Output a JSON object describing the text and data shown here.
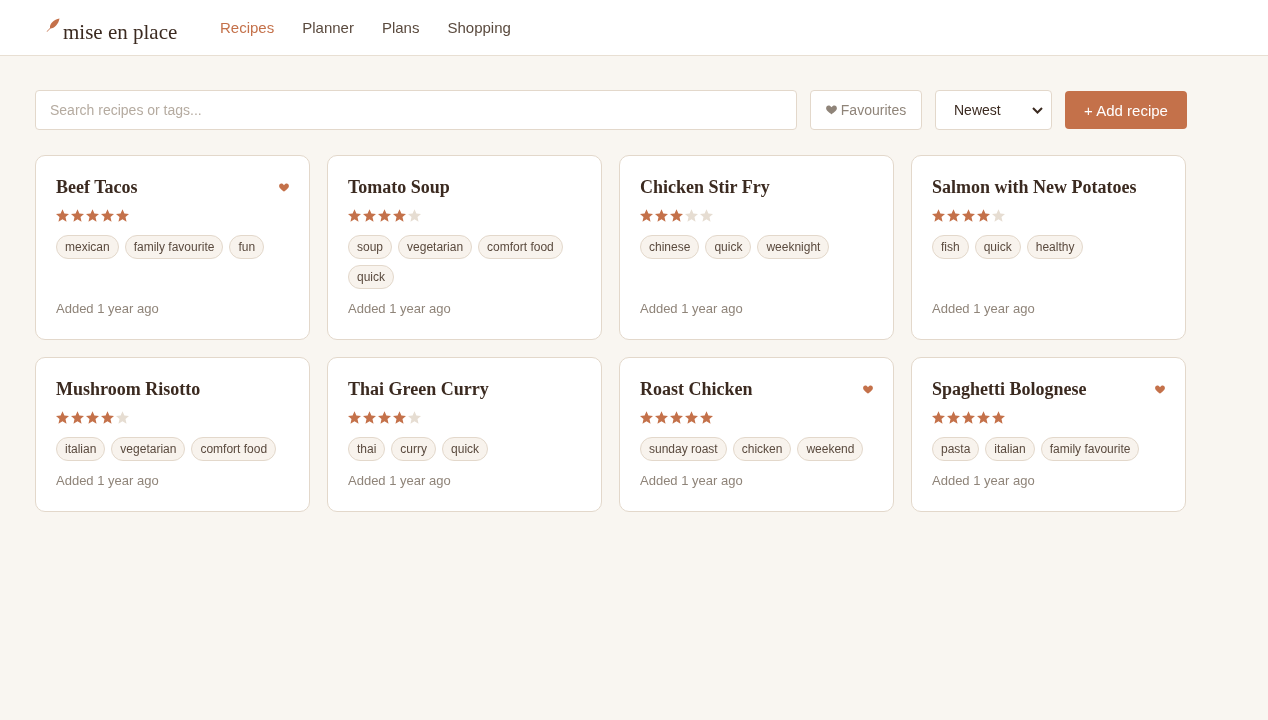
{
  "header": {
    "logo": "mise en place",
    "nav": [
      {
        "label": "Recipes",
        "selected": true
      },
      {
        "label": "Planner",
        "selected": false
      },
      {
        "label": "Plans",
        "selected": false
      },
      {
        "label": "Shopping",
        "selected": false
      }
    ]
  },
  "toolbar": {
    "search": {
      "placeholder": "Search recipes or tags..."
    },
    "favourites_filter": {
      "label": "Favourites",
      "on": false
    },
    "sort": {
      "value": "Newest"
    },
    "add_button": "+ Add recipe"
  },
  "recipes": [
    {
      "title": "Beef Tacos",
      "favourite": true,
      "stars": 5,
      "tags": [
        "mexican",
        "family favourite",
        "fun"
      ],
      "added": "Added 1 year ago"
    },
    {
      "title": "Tomato Soup",
      "favourite": false,
      "stars": 4,
      "tags": [
        "soup",
        "vegetarian",
        "comfort food",
        "quick"
      ],
      "added": "Added 1 year ago"
    },
    {
      "title": "Chicken Stir Fry",
      "favourite": false,
      "stars": 3,
      "tags": [
        "chinese",
        "quick",
        "weeknight"
      ],
      "added": "Added 1 year ago"
    },
    {
      "title": "Salmon with New Potatoes",
      "favourite": false,
      "stars": 4,
      "tags": [
        "fish",
        "quick",
        "healthy"
      ],
      "added": "Added 1 year ago"
    },
    {
      "title": "Mushroom Risotto",
      "favourite": false,
      "stars": 4,
      "tags": [
        "italian",
        "vegetarian",
        "comfort food"
      ],
      "added": "Added 1 year ago"
    },
    {
      "title": "Thai Green Curry",
      "favourite": false,
      "stars": 4,
      "tags": [
        "thai",
        "curry",
        "quick"
      ],
      "added": "Added 1 year ago"
    },
    {
      "title": "Roast Chicken",
      "favourite": true,
      "stars": 5,
      "tags": [
        "sunday roast",
        "chicken",
        "weekend"
      ],
      "added": "Added 1 year ago"
    },
    {
      "title": "Spaghetti Bolognese",
      "favourite": true,
      "stars": 5,
      "tags": [
        "pasta",
        "italian",
        "family favourite"
      ],
      "added": "Added 1 year ago"
    }
  ]
}
